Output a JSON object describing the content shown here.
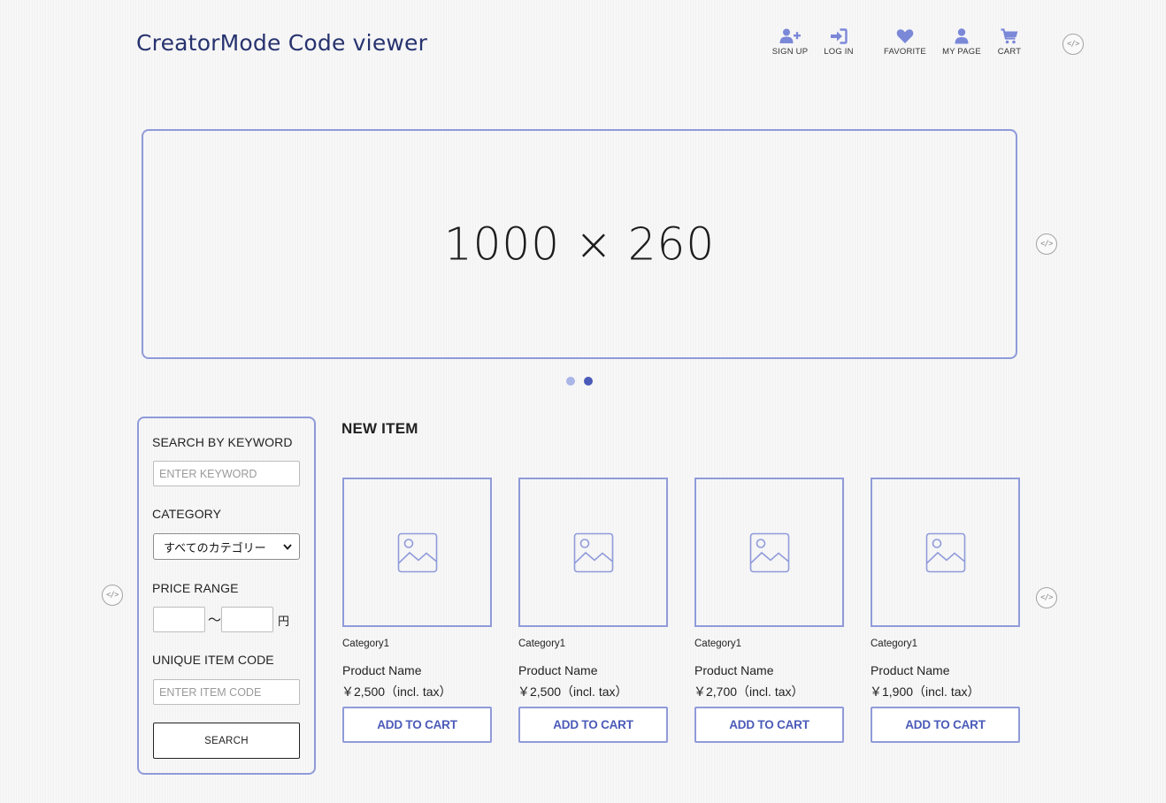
{
  "header": {
    "title": "CreatorMode Code viewer",
    "nav": [
      {
        "label": "SIGN UP",
        "icon": "user-plus-icon"
      },
      {
        "label": "LOG IN",
        "icon": "sign-in-icon"
      },
      {
        "label": "FAVORITE",
        "icon": "heart-icon"
      },
      {
        "label": "MY PAGE",
        "icon": "user-icon"
      },
      {
        "label": "CART",
        "icon": "cart-icon"
      }
    ],
    "code_icon": "</>"
  },
  "banner": {
    "placeholder_text": "1000 × 260",
    "code_icon": "</>",
    "slides": 2,
    "active_slide": 2
  },
  "search": {
    "keyword_label": "SEARCH BY KEYWORD",
    "keyword_placeholder": "ENTER KEYWORD",
    "category_label": "CATEGORY",
    "category_selected": "すべてのカテゴリー",
    "price_label": "PRICE RANGE",
    "price_separator": "〜",
    "currency": "円",
    "code_label": "UNIQUE ITEM CODE",
    "code_placeholder": "ENTER ITEM CODE",
    "button_label": "SEARCH",
    "code_icon": "</>"
  },
  "products": {
    "section_title": "NEW ITEM",
    "code_icon": "</>",
    "items": [
      {
        "category": "Category1",
        "name": "Product Name",
        "price": "￥2,500（incl. tax）",
        "button": "ADD TO CART"
      },
      {
        "category": "Category1",
        "name": "Product Name",
        "price": "￥2,500（incl. tax）",
        "button": "ADD TO CART"
      },
      {
        "category": "Category1",
        "name": "Product Name",
        "price": "￥2,700（incl. tax）",
        "button": "ADD TO CART"
      },
      {
        "category": "Category1",
        "name": "Product Name",
        "price": "￥1,900（incl. tax）",
        "button": "ADD TO CART"
      }
    ]
  },
  "colors": {
    "accent": "#8f9bd9",
    "accent_dark": "#4a5ab8",
    "title": "#27336e",
    "nav_icon": "#7b88d8",
    "dot_active": "#4a5ab8",
    "dot_inactive": "#aab5e8"
  }
}
